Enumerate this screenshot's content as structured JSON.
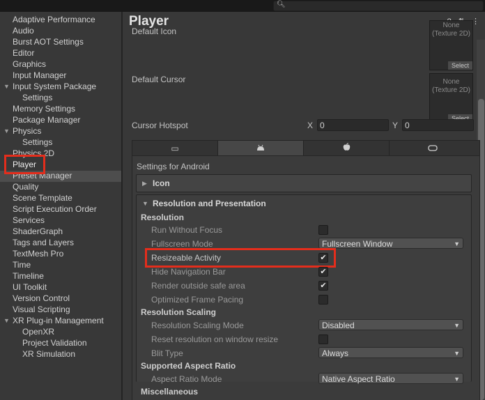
{
  "sidebar": {
    "items": [
      {
        "label": "Adaptive Performance"
      },
      {
        "label": "Audio"
      },
      {
        "label": "Burst AOT Settings"
      },
      {
        "label": "Editor"
      },
      {
        "label": "Graphics"
      },
      {
        "label": "Input Manager"
      },
      {
        "label": "Input System Package"
      },
      {
        "label": "Settings"
      },
      {
        "label": "Memory Settings"
      },
      {
        "label": "Package Manager"
      },
      {
        "label": "Physics"
      },
      {
        "label": "Settings"
      },
      {
        "label": "Physics 2D"
      },
      {
        "label": "Player"
      },
      {
        "label": "Preset Manager"
      },
      {
        "label": "Quality"
      },
      {
        "label": "Scene Template"
      },
      {
        "label": "Script Execution Order"
      },
      {
        "label": "Services"
      },
      {
        "label": "ShaderGraph"
      },
      {
        "label": "Tags and Layers"
      },
      {
        "label": "TextMesh Pro"
      },
      {
        "label": "Time"
      },
      {
        "label": "Timeline"
      },
      {
        "label": "UI Toolkit"
      },
      {
        "label": "Version Control"
      },
      {
        "label": "Visual Scripting"
      },
      {
        "label": "XR Plug-in Management"
      },
      {
        "label": "OpenXR"
      },
      {
        "label": "Project Validation"
      },
      {
        "label": "XR Simulation"
      }
    ]
  },
  "header": {
    "title": "Player",
    "help_icon": "?",
    "settings_icon": "⇅",
    "menu_icon": "⋮"
  },
  "icon_section": {
    "default_icon_label": "Default Icon",
    "default_cursor_label": "Default Cursor",
    "texture_none": "None\n(Texture 2D)",
    "select_label": "Select",
    "cursor_hotspot_label": "Cursor Hotspot",
    "x_label": "X",
    "x_value": "0",
    "y_label": "Y",
    "y_value": "0"
  },
  "platforms": [
    {
      "name": "standalone-tab",
      "glyph": "▭"
    },
    {
      "name": "android-tab",
      "glyph": "🤖"
    },
    {
      "name": "ios-tab",
      "glyph": ""
    },
    {
      "name": "vr-tab",
      "glyph": "⊃⊂"
    }
  ],
  "android": {
    "settings_title": "Settings for Android",
    "icon_fold": "Icon",
    "res_fold": "Resolution and Presentation",
    "resolution_header": "Resolution",
    "run_without_focus": "Run Without Focus",
    "fullscreen_mode": "Fullscreen Mode",
    "fullscreen_mode_value": "Fullscreen Window",
    "resizeable_activity": "Resizeable Activity",
    "hide_nav_bar": "Hide Navigation Bar",
    "render_outside_safe": "Render outside safe area",
    "optimized_frame_pacing": "Optimized Frame Pacing",
    "resolution_scaling_header": "Resolution Scaling",
    "resolution_scaling_mode": "Resolution Scaling Mode",
    "resolution_scaling_mode_value": "Disabled",
    "reset_resolution": "Reset resolution on window resize",
    "blit_type": "Blit Type",
    "blit_type_value": "Always",
    "aspect_ratio_header": "Supported Aspect Ratio",
    "aspect_ratio_mode": "Aspect Ratio Mode",
    "aspect_ratio_mode_value": "Native Aspect Ratio",
    "misc_header": "Miscellaneous"
  },
  "checkbox_states": {
    "run_without_focus": false,
    "resizeable_activity": true,
    "hide_nav_bar": true,
    "render_outside_safe": true,
    "optimized_frame_pacing": false,
    "reset_resolution": false
  },
  "colors": {
    "highlight": "#e42d1c",
    "selected_row": "#4d4d4d"
  }
}
